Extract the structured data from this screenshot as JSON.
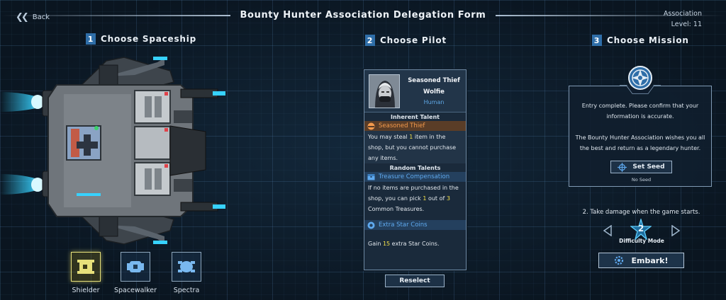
{
  "header": {
    "back_label": "Back",
    "title": "Bounty Hunter Association Delegation Form",
    "association_label": "Association",
    "level_label": "Level: 11"
  },
  "sections": [
    {
      "number": "1",
      "label": "Choose Spaceship"
    },
    {
      "number": "2",
      "label": "Choose Pilot"
    },
    {
      "number": "3",
      "label": "Choose Mission"
    }
  ],
  "ships": [
    {
      "name": "Shielder",
      "selected": true
    },
    {
      "name": "Spacewalker",
      "selected": false
    },
    {
      "name": "Spectra",
      "selected": false
    }
  ],
  "pilot": {
    "title": "Seasoned Thief",
    "name": "Wolfie",
    "race": "Human",
    "inherent_header": "Inherent Talent",
    "inherent": {
      "name": "Seasoned Thief",
      "desc_a": "You may steal ",
      "desc_num": "1",
      "desc_b": " item in the shop, but you cannot purchase any items."
    },
    "random_header": "Random Talents",
    "random": [
      {
        "name": "Treasure Compensation",
        "desc_a": "If no items are purchased in the shop, you can pick ",
        "num1": "1",
        "desc_b": " out of ",
        "num2": "3",
        "desc_c": " Common Treasures."
      },
      {
        "name": "Extra Star Coins",
        "desc_a": "Gain ",
        "num1": "15",
        "desc_b": " extra Star Coins."
      }
    ],
    "reselect_label": "Reselect"
  },
  "mission": {
    "text1": "Entry complete. Please confirm that your information is accurate.",
    "text2": "The Bounty Hunter Association wishes you all the best and return as a legendary hunter.",
    "set_seed_label": "Set Seed",
    "seed_value": "No Seed",
    "difficulty_desc": "2. Take damage when the game starts.",
    "difficulty_level": "2",
    "difficulty_label": "Difficulty Mode",
    "embark_label": "Embark!"
  },
  "colors": {
    "accent_blue": "#2f6ea8",
    "talent_orange": "#f39a4d",
    "talent_blue": "#5faaf0",
    "highlight_yellow": "#f4e14a",
    "thruster_cyan": "#37d2ff",
    "selected_ship": "#e6e07a"
  },
  "icons": {
    "back": "double-chevron-left-icon",
    "association_emblem": "compass-star-icon",
    "seed": "crosshair-icon",
    "embark": "gear-icon",
    "prev": "triangle-left-icon",
    "next": "triangle-right-icon"
  }
}
